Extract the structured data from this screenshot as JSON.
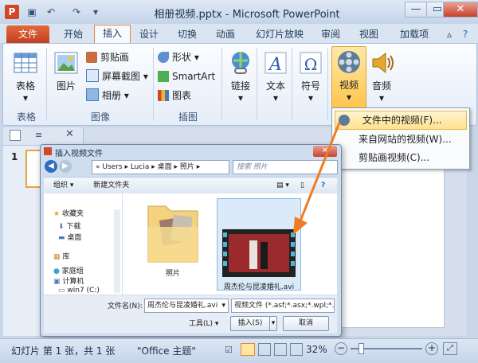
{
  "window": {
    "title": "相册视频.pptx - Microsoft PowerPoint"
  },
  "tabs": [
    "文件",
    "开始",
    "插入",
    "设计",
    "切换",
    "动画",
    "幻灯片放映",
    "审阅",
    "视图",
    "加载项"
  ],
  "ribbon": {
    "table": {
      "label": "表格",
      "group": "表格"
    },
    "picture": {
      "label": "图片"
    },
    "clip_art": "剪贴画",
    "screenshot": "屏幕截图",
    "album": "相册",
    "image_group": "图像",
    "shapes": "形状",
    "smartart": "SmartArt",
    "chart": "图表",
    "illus_group": "插图",
    "link": "链接",
    "text": "文本",
    "symbol": "符号",
    "video": "视频",
    "audio": "音频"
  },
  "video_menu": [
    "文件中的视频(F)...",
    "来自网站的视频(W)...",
    "剪贴画视频(C)..."
  ],
  "dialog": {
    "title": "插入视频文件",
    "address": [
      "Users",
      "Lucia",
      "桌面",
      "照片"
    ],
    "search_placeholder": "搜索 照片",
    "organize": "组织 ▾",
    "new_folder": "新建文件夹",
    "nav": [
      "收藏夹",
      "下载",
      "桌面",
      "库",
      "家庭组",
      "计算机",
      "win7 (C:)"
    ],
    "files": [
      {
        "name": "照片",
        "type": "folder"
      },
      {
        "name": "周杰伦与昆凌婚礼.avi",
        "type": "video"
      }
    ],
    "filename_label": "文件名(N):",
    "filename_value": "周杰伦与昆凌婚礼.avi",
    "filetype_value": "视频文件 (*.asf;*.asx;*.wpl;*.wm",
    "tools": "工具(L)",
    "insert_button": "插入(S)",
    "cancel_button": "取消"
  },
  "status": {
    "slide": "幻灯片 第 1 张，共 1 张",
    "theme": "\"Office 主题\"",
    "zoom": "32%"
  },
  "panel": {
    "slide_number": "1"
  }
}
